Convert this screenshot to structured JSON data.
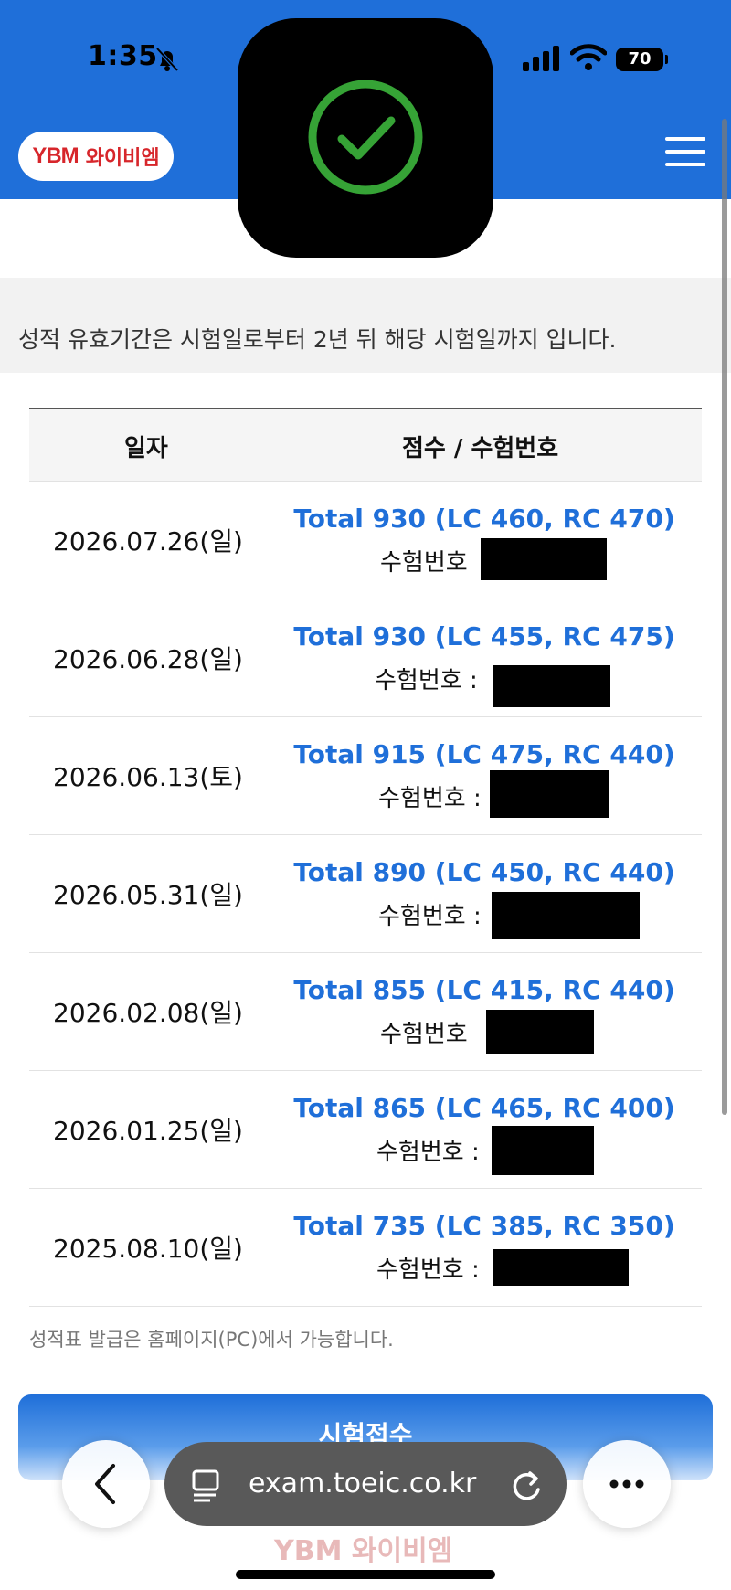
{
  "status_bar": {
    "time": "1:35",
    "battery": "70"
  },
  "header": {
    "logo_mark": "YBM",
    "logo_text": "와이비엠"
  },
  "notice": "성적 유효기간은 시험일로부터 2년 뒤 해당 시험일까지 입니다.",
  "table": {
    "headers": {
      "date": "일자",
      "score": "점수 / 수험번호"
    },
    "rows": [
      {
        "date": "2026.07.26(일)",
        "score": "Total 930 (LC 460, RC 470)",
        "id_label": "수험번호"
      },
      {
        "date": "2026.06.28(일)",
        "score": "Total 930 (LC 455, RC 475)",
        "id_label": "수험번호 :"
      },
      {
        "date": "2026.06.13(토)",
        "score": "Total 915 (LC 475, RC 440)",
        "id_label": "수험번호 :"
      },
      {
        "date": "2026.05.31(일)",
        "score": "Total 890 (LC 450, RC 440)",
        "id_label": "수험번호 :"
      },
      {
        "date": "2026.02.08(일)",
        "score": "Total 855 (LC 415, RC 440)",
        "id_label": "수험번호"
      },
      {
        "date": "2026.01.25(일)",
        "score": "Total 865 (LC 465, RC 400)",
        "id_label": "수험번호 :"
      },
      {
        "date": "2025.08.10(일)",
        "score": "Total 735 (LC 385, RC 350)",
        "id_label": "수험번호 :"
      }
    ]
  },
  "footnote": "성적표 발급은 홈페이지(PC)에서 가능합니다.",
  "apply_button": "시험접수",
  "browser": {
    "url": "exam.toeic.co.kr"
  },
  "footer_logo": "YBM 와이비엠",
  "colors": {
    "brand_blue": "#1f6fd9",
    "score_blue": "#1f6fd9",
    "logo_red": "#d7262b",
    "check_green": "#3fbf3f"
  },
  "icons": [
    "bell-slash-icon",
    "signal-icon",
    "wifi-icon",
    "battery-icon",
    "menu-icon",
    "checkmark-icon",
    "back-chevron-icon",
    "tabs-icon",
    "reload-icon",
    "more-icon"
  ]
}
